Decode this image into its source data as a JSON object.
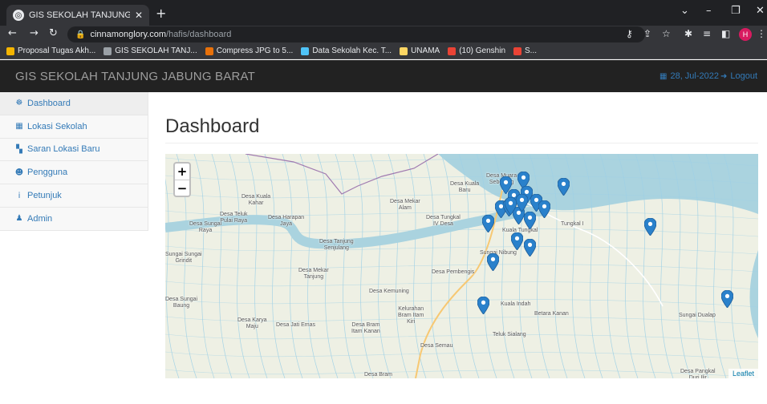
{
  "browser": {
    "tab_title": "GIS SEKOLAH TANJUNG JABUNG",
    "url_host": "cinnamonglory.com",
    "url_path": "/hafis/dashboard",
    "profile_initial": "H",
    "bookmarks": [
      {
        "label": "Proposal Tugas Akh...",
        "color": "#f4b400"
      },
      {
        "label": "GIS SEKOLAH TANJ...",
        "color": "#9aa0a6"
      },
      {
        "label": "Compress JPG to 5...",
        "color": "#e8710a"
      },
      {
        "label": "Data Sekolah Kec. T...",
        "color": "#4fc3f7"
      },
      {
        "label": "UNAMA",
        "color": "#fdd663"
      },
      {
        "label": "(10) Genshin",
        "color": "#ea4335"
      },
      {
        "label": "S...",
        "color": "#ea4335"
      }
    ]
  },
  "app": {
    "brand": "GIS SEKOLAH TANJUNG JABUNG BARAT",
    "date": "28, Jul-2022",
    "logout": "Logout"
  },
  "sidebar": {
    "items": [
      {
        "label": "Dashboard",
        "icon": "tachometer-icon",
        "glyph": "☸"
      },
      {
        "label": "Lokasi Sekolah",
        "icon": "table-icon",
        "glyph": "▦"
      },
      {
        "label": "Saran Lokasi Baru",
        "icon": "map-icon",
        "glyph": "▚"
      },
      {
        "label": "Pengguna",
        "icon": "users-icon",
        "glyph": "☻"
      },
      {
        "label": "Petunjuk",
        "icon": "info-icon",
        "glyph": "i"
      },
      {
        "label": "Admin",
        "icon": "user-icon",
        "glyph": "♟"
      }
    ]
  },
  "main": {
    "title": "Dashboard"
  },
  "map": {
    "zoom_in": "+",
    "zoom_out": "−",
    "attribution": "Leaflet",
    "colors": {
      "water": "#aad3df",
      "land": "#eef0e4",
      "canal": "#9ed0e6",
      "marker": "#2a81cb"
    },
    "places": [
      {
        "name": "Desa Kuala\nKahar"
      },
      {
        "name": "Desa Teluk\nPulai Raya"
      },
      {
        "name": "Desa Harapan\nJaya"
      },
      {
        "name": "Desa Sungai\nRaya"
      },
      {
        "name": "Desa Mekar\nAlam"
      },
      {
        "name": "Desa Kuala\nBaru"
      },
      {
        "name": "Desa Muara\nSeberang"
      },
      {
        "name": "Desa Tungkal\nIV Desa"
      },
      {
        "name": "Kuala Tungkal"
      },
      {
        "name": "Tungkal I"
      },
      {
        "name": "Desa Tanjung\nSenjulang"
      },
      {
        "name": "Sungai Sungai\nGrindit"
      },
      {
        "name": "Sungai Nibung"
      },
      {
        "name": "Desa Mekar\nTanjung"
      },
      {
        "name": "Desa Pembengis"
      },
      {
        "name": "Desa Kemuning"
      },
      {
        "name": "Desa Sungai\nBaung"
      },
      {
        "name": "Kelurahan\nBram Itam\nKiri"
      },
      {
        "name": "Kuala Indah"
      },
      {
        "name": "Betara Kanan"
      },
      {
        "name": "Desa Karya\nMaju"
      },
      {
        "name": "Desa Jati Emas"
      },
      {
        "name": "Desa Bram\nItam Kanan"
      },
      {
        "name": "Teluk Sialang"
      },
      {
        "name": "Desa Semau"
      },
      {
        "name": "Desa Bram"
      },
      {
        "name": "Sungai Dualap"
      },
      {
        "name": "Desa Pangkal\nDuri Ilir"
      }
    ]
  }
}
